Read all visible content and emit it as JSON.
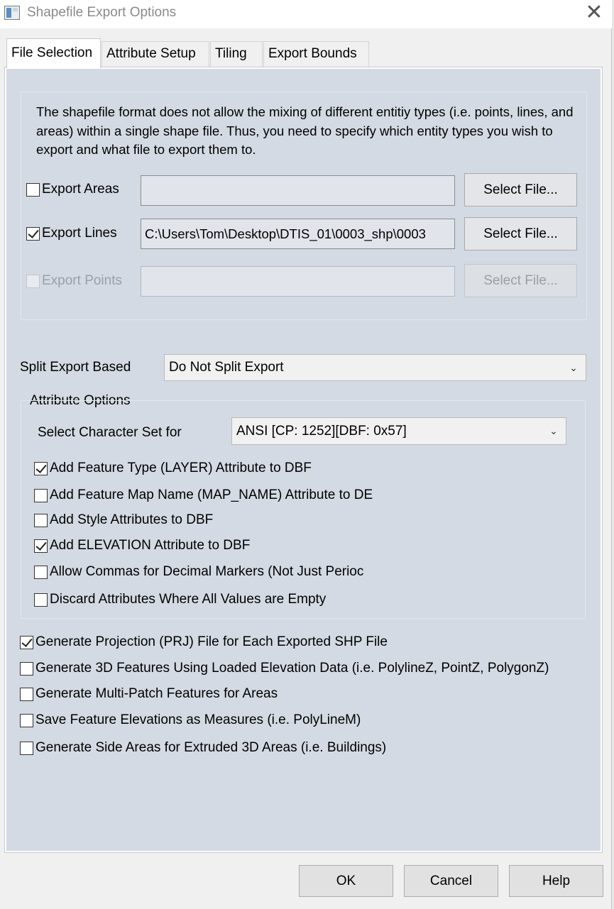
{
  "window": {
    "title": "Shapefile Export Options",
    "close_glyph": "✕",
    "icon": "app-window-icon"
  },
  "tabs": [
    {
      "label": "File Selection",
      "active": true
    },
    {
      "label": "Attribute Setup",
      "active": false
    },
    {
      "label": "Tiling",
      "active": false
    },
    {
      "label": "Export Bounds",
      "active": false
    }
  ],
  "file_selection": {
    "description": "The shapefile format does not allow the mixing of different entitiy types (i.e. points, lines, and areas) within a single shape file. Thus, you need to specify which entity types you wish to export and what file to export them to.",
    "export_areas": {
      "label": "Export Areas",
      "checked": false,
      "path": "",
      "button": "Select File..."
    },
    "export_lines": {
      "label": "Export Lines",
      "checked": true,
      "path": "C:\\Users\\Tom\\Desktop\\DTIS_01\\0003_shp\\0003",
      "button": "Select File..."
    },
    "export_points": {
      "label": "Export Points",
      "checked": false,
      "disabled": true,
      "path": "",
      "button": "Select File..."
    }
  },
  "split_export": {
    "label": "Split Export Based",
    "value": "Do Not Split Export"
  },
  "attribute_options": {
    "legend": "Attribute Options",
    "charset_label": "Select Character Set for",
    "charset_value": "ANSI [CP: 1252][DBF: 0x57]",
    "checkboxes": [
      {
        "label": "Add Feature Type (LAYER) Attribute to DBF",
        "checked": true
      },
      {
        "label": "Add Feature Map Name (MAP_NAME) Attribute to DE",
        "checked": false
      },
      {
        "label": "Add Style Attributes to DBF",
        "checked": false
      },
      {
        "label": "Add ELEVATION Attribute to DBF",
        "checked": true
      },
      {
        "label": "Allow Commas for Decimal Markers (Not Just Perioc",
        "checked": false
      },
      {
        "label": "Discard Attributes Where All Values are Empty",
        "checked": false
      }
    ]
  },
  "general_options": [
    {
      "label": "Generate Projection (PRJ) File for Each Exported SHP File",
      "checked": true
    },
    {
      "label": "Generate 3D Features Using Loaded Elevation Data (i.e. PolylineZ, PointZ, PolygonZ)",
      "checked": false
    },
    {
      "label": "Generate Multi-Patch Features for Areas",
      "checked": false
    },
    {
      "label": "Save Feature Elevations as Measures (i.e. PolyLineM)",
      "checked": false
    },
    {
      "label": "Generate Side Areas for Extruded 3D Areas (i.e. Buildings)",
      "checked": false
    }
  ],
  "footer": {
    "ok": "OK",
    "cancel": "Cancel",
    "help": "Help"
  },
  "icons": {
    "dropdown": "chevron-down-icon",
    "check": "checkmark-icon"
  }
}
